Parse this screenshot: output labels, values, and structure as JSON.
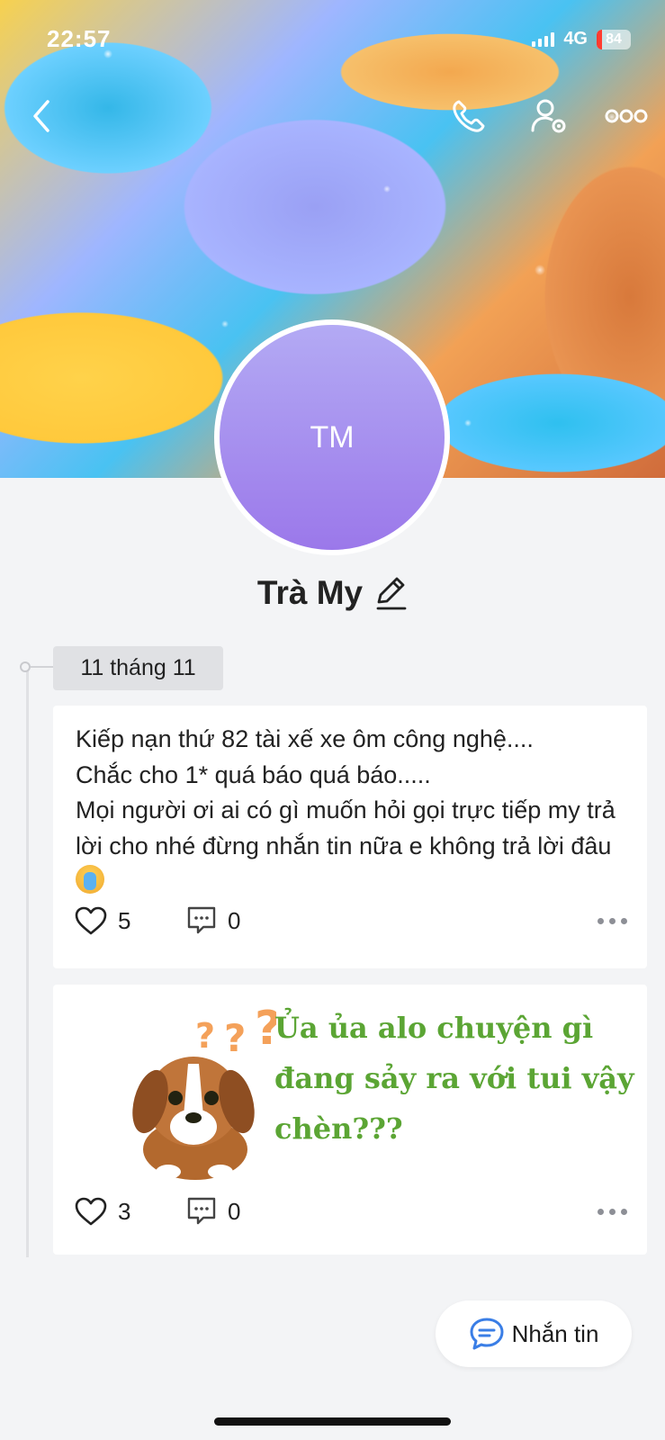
{
  "status_bar": {
    "time": "22:57",
    "network": "4G",
    "battery": "84"
  },
  "profile": {
    "initials": "TM",
    "name": "Trà My"
  },
  "timeline": {
    "date_label": "11 tháng 11"
  },
  "posts": [
    {
      "text": "Kiếp nạn thứ 82 tài xế xe ôm công nghệ....\nChắc cho 1* quá báo quá báo.....\nMọi người ơi ai có gì muốn hỏi gọi trực tiếp my trả lời cho nhé đừng nhắn tin nữa e không trả lời đâu",
      "likes": "5",
      "comments": "0"
    },
    {
      "sticker_text": "Ủa ủa alo chuyện gì đang sảy ra với tui vậy chèn???",
      "likes": "3",
      "comments": "0"
    }
  ],
  "actions": {
    "message_label": "Nhắn tin"
  },
  "icons": {
    "back": "chevron-left-icon",
    "call": "phone-icon",
    "settings": "user-settings-icon",
    "more": "more-horizontal-icon",
    "edit": "pencil-icon",
    "like": "heart-icon",
    "comment": "comment-icon",
    "message": "chat-bubble-icon"
  },
  "colors": {
    "accent": "#3a7ee6",
    "avatar_top": "#b3aaf4",
    "avatar_bottom": "#9b78ea",
    "sticker_text": "#5ba534"
  }
}
